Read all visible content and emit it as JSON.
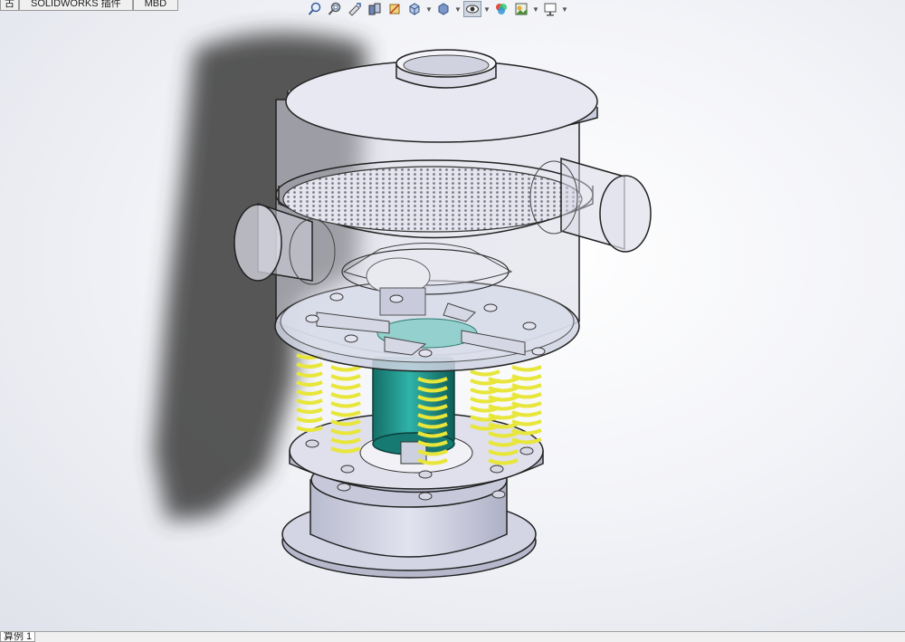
{
  "tabs": {
    "items": [
      {
        "label": "古"
      },
      {
        "label": "SOLIDWORKS 插件"
      },
      {
        "label": "MBD"
      }
    ]
  },
  "hud_toolbar": {
    "icons": [
      "zoom-to-fit-icon",
      "zoom-to-area-icon",
      "previous-view-icon",
      "section-view-icon",
      "dynamic-annotation-view-icon",
      "view-orientation-icon",
      "display-style-icon",
      "hide-show-items-icon",
      "edit-appearance-icon",
      "apply-scene-icon",
      "view-settings-icon"
    ]
  },
  "bottom_tab": {
    "label": "算例 1"
  },
  "colors": {
    "spring": "#e8e63a",
    "motor": "#1f8f86",
    "metal": "#c9cbdc",
    "glass": "#d8d8e6"
  }
}
